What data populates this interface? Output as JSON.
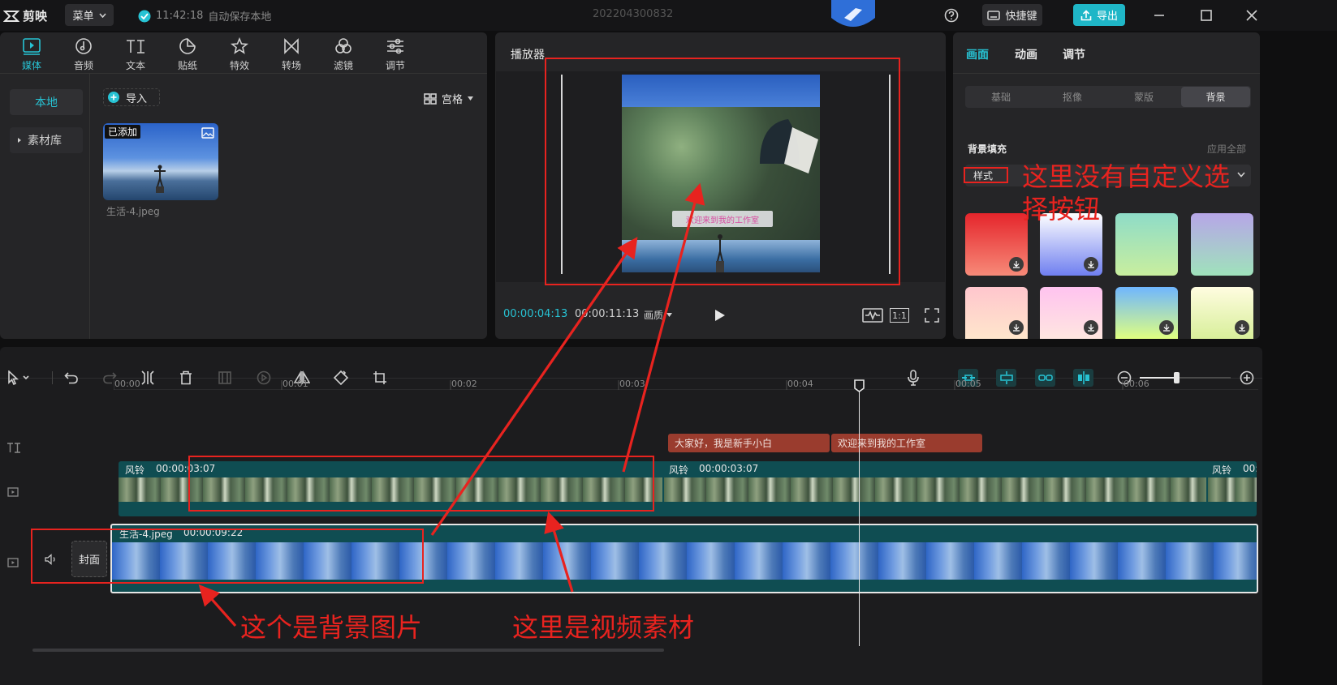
{
  "app": {
    "logo_text": "剪映",
    "menu_label": "菜单",
    "autosave_time": "11:42:18",
    "autosave_text": "自动保存本地",
    "project_name": "202204300832",
    "shortcut_label": "快捷键",
    "export_label": "导出"
  },
  "media_panel": {
    "tabs": [
      {
        "label": "媒体",
        "icon": "media-icon"
      },
      {
        "label": "音频",
        "icon": "audio-icon"
      },
      {
        "label": "文本",
        "icon": "text-icon"
      },
      {
        "label": "贴纸",
        "icon": "sticker-icon"
      },
      {
        "label": "特效",
        "icon": "effects-icon"
      },
      {
        "label": "转场",
        "icon": "transition-icon"
      },
      {
        "label": "滤镜",
        "icon": "filter-icon"
      },
      {
        "label": "调节",
        "icon": "adjust-icon"
      }
    ],
    "side_local": "本地",
    "side_library": "素材库",
    "import_label": "导入",
    "view_label": "宫格",
    "asset": {
      "badge": "已添加",
      "name": "生活-4.jpeg"
    }
  },
  "player": {
    "title": "播放器",
    "current_time": "00:00:04:13",
    "total_time": "00:00:11:13",
    "quality_label": "画质",
    "ratio_label": "1:1",
    "caption": "欢迎来到我的工作室"
  },
  "inspector": {
    "tabs": [
      "画面",
      "动画",
      "调节"
    ],
    "subtabs": [
      "基础",
      "抠像",
      "蒙版",
      "背景"
    ],
    "active_subtab": "背景",
    "section_title": "背景填充",
    "apply_all": "应用全部",
    "style_label": "样式",
    "colors": {
      "accent": "#27c3d4",
      "annotation": "#e8231f"
    }
  },
  "timeline": {
    "ruler_labels": [
      "00:00",
      "00:01",
      "00:02",
      "00:03",
      "00:04",
      "00:05",
      "00:06"
    ],
    "text_clips": [
      "大家好，我是新手小白",
      "欢迎来到我的工作室"
    ],
    "video_clip": {
      "name": "风铃",
      "duration": "00:00:03:07",
      "name_short": "风铃",
      "duration_short": "00:"
    },
    "bg_clip": {
      "name": "生活-4.jpeg",
      "duration": "00:00:09:22"
    },
    "cover_label": "封面"
  },
  "annotations": {
    "no_custom": "这里没有自定义选择按钮",
    "bg_image": "这个是背景图片",
    "video_material": "这里是视频素材"
  }
}
